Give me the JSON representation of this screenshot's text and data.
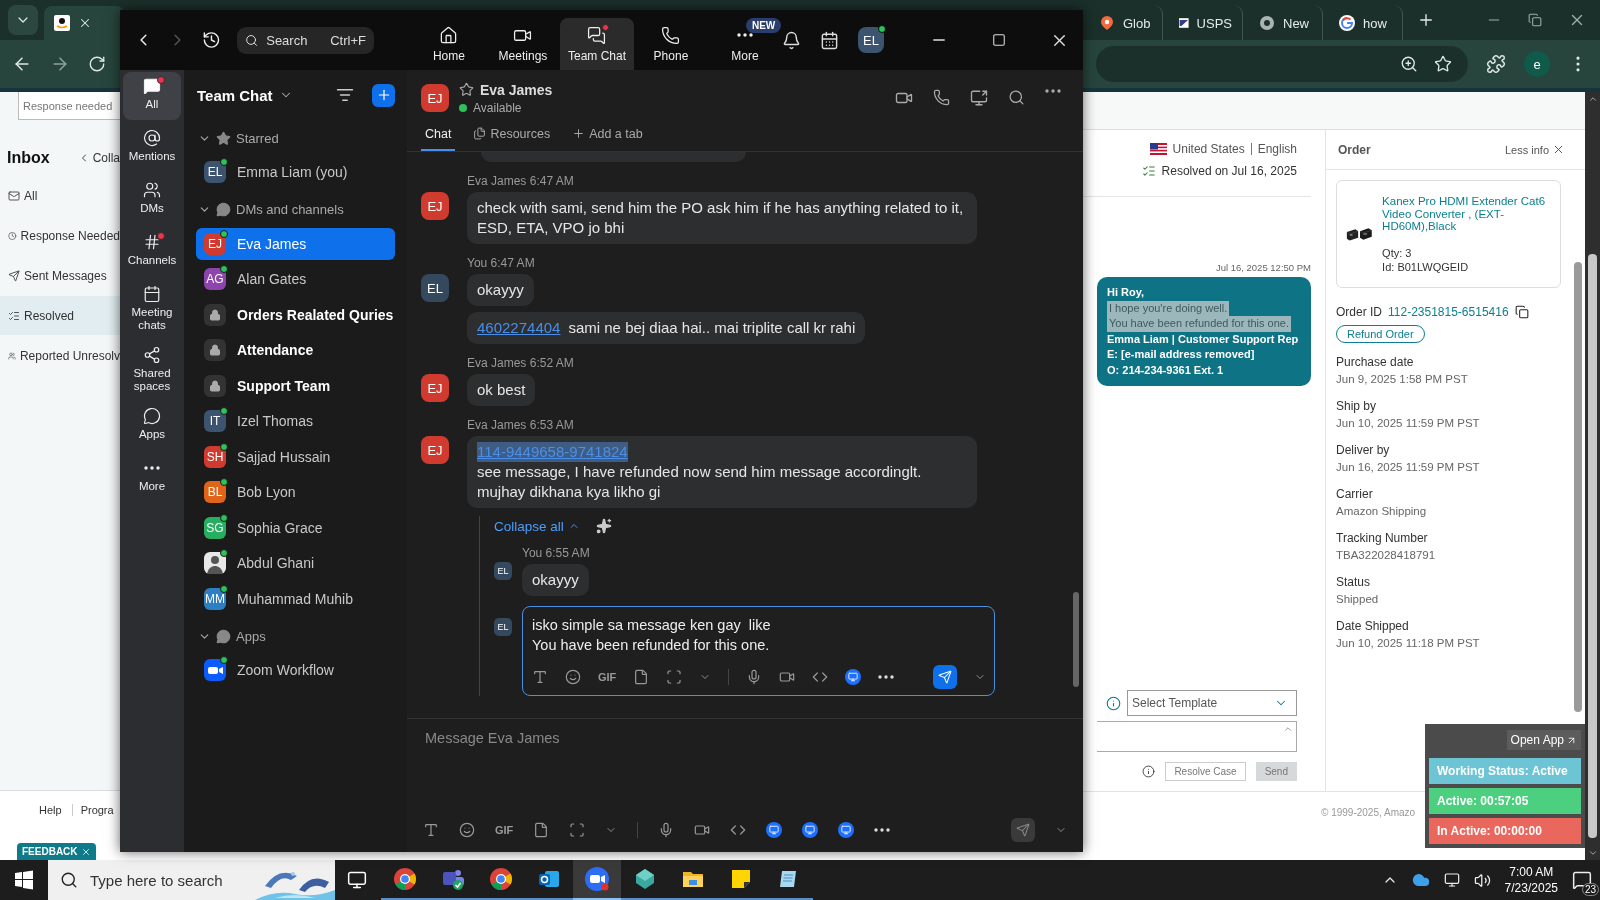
{
  "browser": {
    "tabs": [
      {
        "kind": "amazon",
        "selected": true
      },
      {
        "kind": "pin",
        "title": "Glob",
        "selected": false
      },
      {
        "kind": "usps",
        "title": "USPS",
        "selected": false
      },
      {
        "kind": "chrome",
        "title": "New",
        "selected": false
      },
      {
        "kind": "google",
        "title": "how",
        "selected": false
      }
    ],
    "profile": "e"
  },
  "seller": {
    "search_placeholder": "Response needed",
    "inbox": "Inbox",
    "collapse": "Colla",
    "nav": [
      {
        "label": "All",
        "kind": "mail",
        "selected": false
      },
      {
        "label": "Response Needed",
        "kind": "clock",
        "selected": false
      },
      {
        "label": "Sent Messages",
        "kind": "send",
        "selected": false
      },
      {
        "label": "Resolved",
        "kind": "resolved",
        "selected": true
      },
      {
        "label": "Reported Unresolv",
        "kind": "report",
        "selected": false
      }
    ],
    "footer_links": [
      "Help",
      "Progra"
    ],
    "feedback": "FEEDBACK",
    "country": "United States",
    "language": "English",
    "resolved": "Resolved on Jul 16, 2025",
    "message_time": "Jul 16, 2025 12:50 PM",
    "message_lines": [
      {
        "text": "Hi Roy,",
        "highlighted": false
      },
      {
        "text": "I hope you're doing well.",
        "highlighted": true
      },
      {
        "text": "You have been refunded for this one.",
        "highlighted": true
      },
      {
        "text": "Emma Liam | Customer Support Rep",
        "highlighted": false
      },
      {
        "text": "E: [e-mail address removed]",
        "highlighted": false
      },
      {
        "text": "O: 214-234-9361 Ext. 1",
        "highlighted": false
      }
    ],
    "template_placeholder": "Select Template",
    "resolve_button": "Resolve Case",
    "send_button": "Send",
    "send_disabled": true,
    "copyright": "© 1999-2025, Amazo",
    "order": {
      "title": "Order",
      "less_info": "Less info",
      "product": "Kanex Pro HDMI Extender Cat6 Video Converter , (EXT-HD60M),Black",
      "qty": "Qty: 3",
      "id": "Id: B01LWQGEID",
      "order_id_label": "Order ID",
      "order_id": "112-2351815-6515416",
      "refund": "Refund Order",
      "fields": [
        {
          "label": "Purchase date",
          "value": "Jun 9, 2025 1:58 PM PST"
        },
        {
          "label": "Ship by",
          "value": "Jun 10, 2025 11:59 PM PST"
        },
        {
          "label": "Deliver by",
          "value": "Jun 16, 2025 11:59 PM PST"
        },
        {
          "label": "Carrier",
          "value": "Amazon Shipping"
        },
        {
          "label": "Tracking Number",
          "value": "TBA322028418791"
        },
        {
          "label": "Status",
          "value": "Shipped"
        },
        {
          "label": "Date Shipped",
          "value": "Jun 10, 2025 11:18 PM PST"
        }
      ]
    }
  },
  "tracker": {
    "open_app": "Open App",
    "bars": [
      {
        "label": "Working Status: Active",
        "color": "#6cc4d4"
      },
      {
        "label": "Active: 00:57:05",
        "color": "#4ccf7e"
      },
      {
        "label": "In Active: 00:00:00",
        "color": "#e9675d"
      }
    ]
  },
  "zoom": {
    "search": {
      "placeholder": "Search",
      "shortcut": "Ctrl+F"
    },
    "nav": [
      {
        "label": "Home",
        "kind": "home",
        "selected": false,
        "dot": false
      },
      {
        "label": "Meetings",
        "kind": "video",
        "selected": false,
        "dot": false
      },
      {
        "label": "Team Chat",
        "kind": "chat",
        "selected": true,
        "dot": true
      },
      {
        "label": "Phone",
        "kind": "phone",
        "selected": false,
        "dot": false
      },
      {
        "label": "More",
        "kind": "more",
        "selected": false,
        "dot": false,
        "badge": "NEW"
      }
    ],
    "user": {
      "initials": "EL",
      "online": true
    },
    "rail": [
      {
        "label": "All",
        "kind": "all",
        "selected": true,
        "dot": true
      },
      {
        "label": "Mentions",
        "kind": "at",
        "selected": false,
        "dot": false
      },
      {
        "label": "DMs",
        "kind": "people",
        "selected": false,
        "dot": false
      },
      {
        "label": "Channels",
        "kind": "hash",
        "selected": false,
        "dot": true
      },
      {
        "label": "Meeting chats",
        "kind": "calendar",
        "selected": false,
        "dot": false
      },
      {
        "label": "Shared spaces",
        "kind": "share",
        "selected": false,
        "dot": false
      },
      {
        "label": "Apps",
        "kind": "bubble",
        "selected": false,
        "dot": false
      },
      {
        "label": "More",
        "kind": "dots",
        "selected": false,
        "dot": false
      }
    ],
    "list_title": "Team Chat",
    "sections": [
      {
        "title": "Starred",
        "kind": "star",
        "expanded": true,
        "items": [
          {
            "name": "Emma Liam (you)",
            "kind": "person",
            "initials": "EL",
            "color": "#3c5470",
            "online": true,
            "selected": false
          }
        ]
      },
      {
        "title": "DMs and channels",
        "kind": "bubble",
        "expanded": true,
        "items": [
          {
            "name": "Eva James",
            "kind": "person",
            "initials": "EJ",
            "color": "#d13b2f",
            "online": true,
            "selected": true
          },
          {
            "name": "Alan Gates",
            "kind": "person",
            "initials": "AG",
            "color": "#8e44ad",
            "online": true,
            "selected": false
          },
          {
            "name": "Orders Realated Quries",
            "kind": "channel",
            "unread": true,
            "selected": false
          },
          {
            "name": "Attendance",
            "kind": "channel",
            "unread": true,
            "selected": false
          },
          {
            "name": "Support Team",
            "kind": "channel",
            "unread": true,
            "selected": false
          },
          {
            "name": "Izel Thomas",
            "kind": "person",
            "initials": "IT",
            "color": "#3c5470",
            "online": true,
            "selected": false
          },
          {
            "name": "Sajjad Hussain",
            "kind": "person",
            "initials": "SH",
            "color": "#d13b2f",
            "online": true,
            "selected": false
          },
          {
            "name": "Bob Lyon",
            "kind": "person",
            "initials": "BL",
            "color": "#e0641a",
            "online": true,
            "selected": false
          },
          {
            "name": "Sophia Grace",
            "kind": "person",
            "initials": "SG",
            "color": "#27ae60",
            "online": true,
            "selected": false
          },
          {
            "name": "Abdul Ghani",
            "online": true,
            "selected": false
          },
          {
            "name": "Muhammad Muhib",
            "kind": "person",
            "initials": "MM",
            "color": "#2d7fc1",
            "online": true,
            "selected": false
          }
        ]
      },
      {
        "title": "Apps",
        "kind": "bubble",
        "expanded": true,
        "items": [
          {
            "name": "Zoom Workflow",
            "kind": "app",
            "online": true,
            "selected": false
          }
        ]
      }
    ],
    "chat": {
      "contact": {
        "name": "Eva James",
        "initials": "EJ",
        "color": "#d13b2f",
        "status": "Available",
        "starred": false
      },
      "tabs": [
        {
          "label": "Chat",
          "kind": "chat",
          "selected": true
        },
        {
          "label": "Resources",
          "kind": "files",
          "selected": false
        },
        {
          "label": "Add a tab",
          "kind": "add",
          "selected": false
        }
      ],
      "messages": [
        {
          "sender": "Eva James",
          "time": "6:47 AM",
          "initials": "EJ",
          "color": "#d13b2f",
          "bubbles": [
            {
              "text": "check with sami, send him the PO ask him if he has anything related to it, ESD, ETA, VPO jo bhi"
            }
          ]
        },
        {
          "sender": "You",
          "time": "6:47 AM",
          "initials": "EL",
          "color": "#34495e",
          "bubbles": [
            {
              "text": "okayyy"
            },
            {
              "link": "4602274404",
              "highlighted": false,
              "newline": false,
              "text": "sami ne bej diaa hai.. mai triplite call kr rahi"
            }
          ]
        },
        {
          "sender": "Eva James",
          "time": "6:52 AM",
          "initials": "EJ",
          "color": "#d13b2f",
          "bubbles": [
            {
              "text": "ok best"
            }
          ]
        },
        {
          "sender": "Eva James",
          "time": "6:53 AM",
          "initials": "EJ",
          "color": "#d13b2f",
          "bubbles": [
            {
              "link": "114-9449658-9741824",
              "highlighted": true,
              "newline": true,
              "text": "see message, I have refunded now send him message accordinglt. mujhay dikhana kya likho gi"
            }
          ]
        }
      ],
      "thread": {
        "collapse": "Collapse all",
        "replies": [
          {
            "sender": "You",
            "time": "6:55 AM",
            "initials": "EL",
            "text": "okayyy"
          }
        ],
        "draft": {
          "initials": "EL",
          "lines": [
            "isko simple sa message ken gay  like",
            "You have been refunded for this one."
          ],
          "gif": "GIF",
          "send_enabled": true
        }
      },
      "composer": {
        "placeholder": "Message Eva James",
        "gif": "GIF",
        "send_enabled": false
      }
    }
  },
  "taskbar": {
    "search_placeholder": "Type here to search",
    "apps": [
      {
        "kind": "chrome",
        "active": false
      },
      {
        "kind": "teams",
        "active": false
      },
      {
        "kind": "chrome",
        "active": false
      },
      {
        "kind": "outlook",
        "active": false
      },
      {
        "kind": "zoom",
        "active": true
      },
      {
        "kind": "diamond",
        "active": false
      },
      {
        "kind": "folder",
        "active": false
      },
      {
        "kind": "sticky",
        "active": false
      },
      {
        "kind": "notepad",
        "active": false
      }
    ],
    "time": "7:00 AM",
    "date": "7/23/2025",
    "notifications": "23"
  }
}
